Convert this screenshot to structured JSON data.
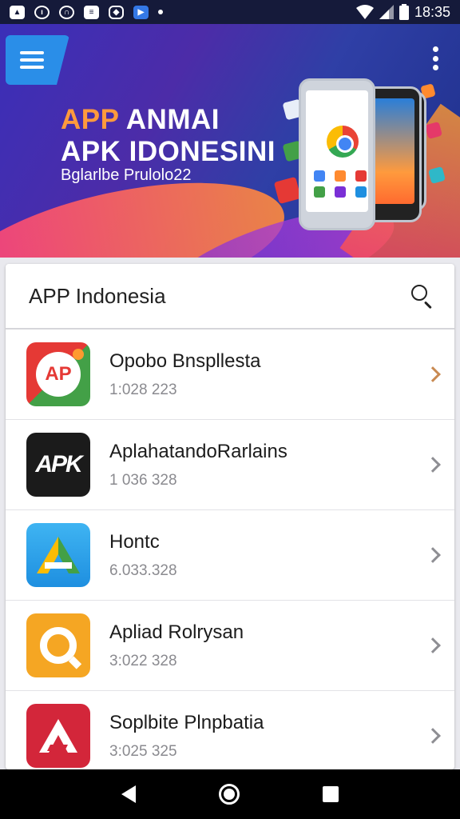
{
  "status_bar": {
    "time": "18:35",
    "left_icons": [
      "gallery-icon",
      "clock-icon",
      "headset-icon",
      "message-icon",
      "shield-icon",
      "play-store-icon",
      "notification-dot-icon"
    ],
    "right_icons": [
      "wifi-icon",
      "signal-icon",
      "battery-icon"
    ]
  },
  "banner": {
    "title_accent": "APP",
    "title_line1_rest": " ANMAI",
    "title_line2": "APK IDONESINI",
    "subtitle": "Bglarlbe Prulolo22",
    "menu_icon": "hamburger-menu-icon",
    "more_icon": "more-vertical-icon"
  },
  "search": {
    "title": "APP Indonesia",
    "icon": "search-icon"
  },
  "apps": [
    {
      "name": "Opobo Bnspllesta",
      "meta": "1:028 223",
      "icon_text": "AP",
      "icon": "ap-app-icon"
    },
    {
      "name": "AplahatandoRarlains",
      "meta": "1 036 328",
      "icon_text": "APK",
      "icon": "apk-app-icon"
    },
    {
      "name": "Hontc",
      "meta": "6.033.328",
      "icon_text": "",
      "icon": "triangle-app-icon"
    },
    {
      "name": "Apliad Rolrysan",
      "meta": "3:022 328",
      "icon_text": "",
      "icon": "q-app-icon"
    },
    {
      "name": "Soplbite Plnpbatia",
      "meta": "3:025 325",
      "icon_text": "",
      "icon": "a-app-icon"
    }
  ],
  "nav": {
    "back": "back-icon",
    "home": "home-icon",
    "recents": "recents-icon"
  },
  "colors": {
    "status_bar": "#151a3a",
    "menu_button": "#2a8ee8",
    "banner_accent": "#ff9a3d"
  }
}
